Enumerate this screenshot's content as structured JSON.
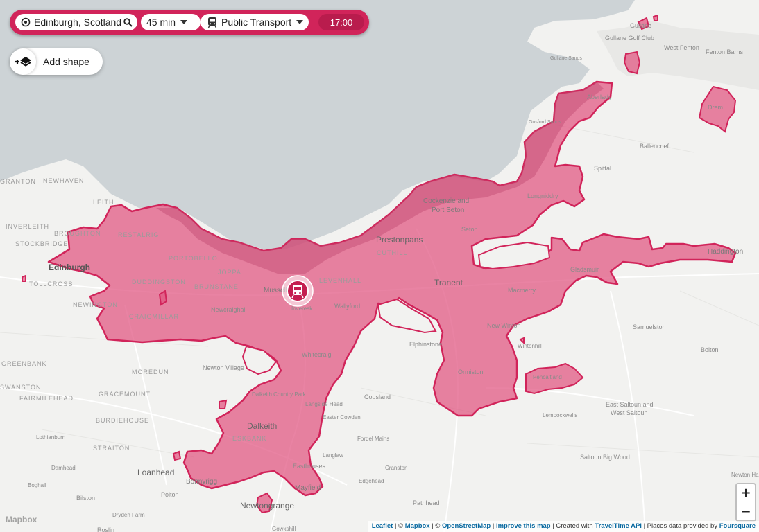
{
  "controls": {
    "location_value": "Edinburgh, Scotland, UK",
    "duration_label": "45 min",
    "transport_label": "Public Transport",
    "time_label": "17:00",
    "add_shape_label": "Add shape"
  },
  "zoom": {
    "in_label": "+",
    "out_label": "−"
  },
  "attribution": {
    "leaflet": "Leaflet",
    "sep1": " | © ",
    "mapbox": "Mapbox",
    "sep2": " | © ",
    "osm": "OpenStreetMap",
    "sep3": " | ",
    "improve": "Improve this map",
    "sep4": " | Created with ",
    "traveltime": "TravelTime API",
    "sep5": " | Places data provided by ",
    "foursquare": "Foursquare"
  },
  "mapbox_logo": "Mapbox",
  "colors": {
    "brand": "#d1245a",
    "isochrone_fill": "#e0537f",
    "water": "#cdd3d6",
    "land": "#f2f2f0"
  },
  "icons": [
    "location-pin-icon",
    "search-icon",
    "train-icon",
    "layers-plus-icon",
    "chevron-down-icon"
  ],
  "map_labels": {
    "gullane": "Gullane",
    "gullane_golf": "Gullane Golf Club",
    "west_fenton": "West Fenton",
    "fenton_barns": "Fenton Barns",
    "gullane_sands": "Gullane Sands",
    "aberlady": "Aberlady",
    "drem": "Drem",
    "gosford": "Gosford Sands",
    "ballencrief": "Ballencrief",
    "spittal": "Spittal",
    "longniddry": "Longniddry",
    "cockenzie": "Cockenzie and",
    "port_seton": "Port Seton",
    "seton": "Seton",
    "prestonpans": "Prestonpans",
    "cuthill": "CUTHILL",
    "haddington": "Haddington",
    "granton": "GRANTON",
    "newhaven": "NEWHAVEN",
    "leith": "LEITH",
    "inverleith": "INVERLEITH",
    "broughton": "BROUGHTON",
    "stockbridge": "STOCKBRIDGE",
    "restalrig": "RESTALRIG",
    "edinburgh": "Edinburgh",
    "tollcross": "TOLLCROSS",
    "portobello": "PORTOBELLO",
    "joppa": "JOPPA",
    "duddingston": "DUDDINGSTON",
    "brunstane": "BRUNSTANE",
    "musselburgh": "Musselburgh",
    "levenhall": "LEVENHALL",
    "tranent": "Tranent",
    "gladsmuir": "Gladsmuir",
    "macmerry": "Macmerry",
    "newington": "NEWINGTON",
    "craigmillar": "CRAIGMILLAR",
    "newcraighall": "Newcraighall",
    "inveresk": "Inveresk",
    "wallyford": "Wallyford",
    "samuelston": "Samuelston",
    "new_winton": "New Winton",
    "elphinstone": "Elphinstone",
    "winton": "Wintonhill",
    "bolton": "Bolton",
    "greenbank": "GREENBANK",
    "moredun": "MOREDUN",
    "newton_village": "Newton Village",
    "whitecraig": "Whitecraig",
    "ormiston": "Ormiston",
    "pencaitland": "Pencaitland",
    "fairmilehead": "FAIRMILEHEAD",
    "gracemount": "GRACEMOUNT",
    "dalkeith_park": "Dalkeith Country Park",
    "langside": "Langside Head",
    "cousland": "Cousland",
    "east_saltoun": "East Saltoun and",
    "west_saltoun": "West Saltoun",
    "swanston": "SWANSTON",
    "burdiehouse": "BURDIEHOUSE",
    "easter_cowden": "Easter Cowden",
    "lempockwells": "Lempockwells",
    "dalkeith": "Dalkeith",
    "eskbank": "ESKBANK",
    "fordel": "Fordel Mains",
    "lothianburn": "Lothianburn",
    "straiton": "STRAITON",
    "saltoun_wood": "Saltoun Big Wood",
    "laglaw": "Langlaw",
    "cranston": "Cranston",
    "damhead": "Damhead",
    "loanhead": "Loanhead",
    "bonnyrigg": "Bonnyrigg",
    "easthouses": "Easthouses",
    "edgehead": "Edgehead",
    "newton_hall": "Newton Hall",
    "boghall": "Boghall",
    "polton": "Polton",
    "mayfield": "Mayfield",
    "bilston": "Bilston",
    "pathhead": "Pathhead",
    "dryden": "Dryden Farm",
    "newtongrange": "Newtongrange",
    "roslin": "Roslin",
    "gorebridge": "Gowkshill"
  }
}
